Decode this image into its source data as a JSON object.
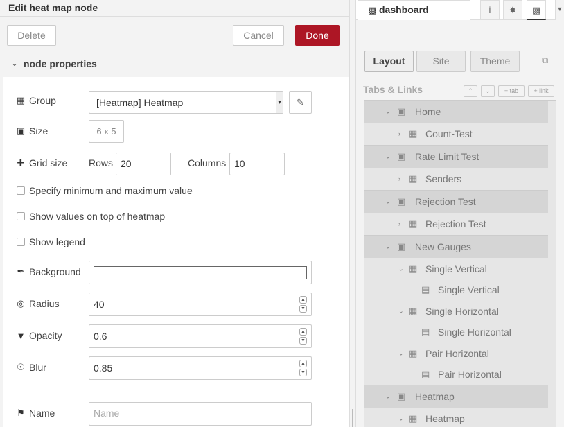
{
  "editor": {
    "title": "Edit heat map node",
    "buttons": {
      "delete": "Delete",
      "cancel": "Cancel",
      "done": "Done"
    },
    "section_title": "node properties",
    "fields": {
      "group": {
        "label": "Group",
        "value": "[Heatmap] Heatmap"
      },
      "size": {
        "label": "Size",
        "value": "6 x 5"
      },
      "grid_size": {
        "label": "Grid size",
        "rows_label": "Rows",
        "rows_value": "20",
        "columns_label": "Columns",
        "columns_value": "10"
      },
      "checks": {
        "minmax": "Specify minimum and maximum value",
        "show_values": "Show values on top of heatmap",
        "show_legend": "Show legend"
      },
      "background": {
        "label": "Background",
        "value": "#ffffff"
      },
      "radius": {
        "label": "Radius",
        "value": "40"
      },
      "opacity": {
        "label": "Opacity",
        "value": "0.6"
      },
      "blur": {
        "label": "Blur",
        "value": "0.85"
      },
      "name": {
        "label": "Name",
        "placeholder": "Name"
      }
    }
  },
  "sidebar": {
    "tab_title": "dashboard",
    "subtabs": {
      "layout": "Layout",
      "site": "Site",
      "theme": "Theme"
    },
    "tabs_links_title": "Tabs & Links",
    "mini_buttons": {
      "add_tab": "+ tab",
      "add_link": "+ link"
    },
    "tree": [
      {
        "kind": "tab",
        "label": "Home"
      },
      {
        "kind": "group",
        "label": "Count-Test",
        "collapsed": true
      },
      {
        "kind": "tab",
        "label": "Rate Limit Test"
      },
      {
        "kind": "group",
        "label": "Senders",
        "collapsed": true
      },
      {
        "kind": "tab",
        "label": "Rejection Test"
      },
      {
        "kind": "group",
        "label": "Rejection Test",
        "collapsed": true
      },
      {
        "kind": "tab",
        "label": "New Gauges"
      },
      {
        "kind": "group",
        "label": "Single Vertical",
        "collapsed": false
      },
      {
        "kind": "widget",
        "label": "Single Vertical"
      },
      {
        "kind": "group",
        "label": "Single Horizontal",
        "collapsed": false
      },
      {
        "kind": "widget",
        "label": "Single Horizontal"
      },
      {
        "kind": "group",
        "label": "Pair Horizontal",
        "collapsed": false
      },
      {
        "kind": "widget",
        "label": "Pair Horizontal"
      },
      {
        "kind": "tab",
        "label": "Heatmap"
      },
      {
        "kind": "group",
        "label": "Heatmap",
        "collapsed": false
      }
    ]
  }
}
